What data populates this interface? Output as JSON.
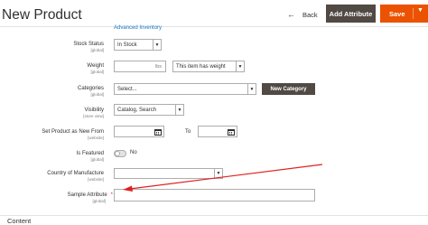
{
  "header": {
    "title": "New Product",
    "back_label": "Back",
    "add_attribute_label": "Add Attribute",
    "save_label": "Save"
  },
  "advanced_link": "Advanced Inventory",
  "form": {
    "stock_status": {
      "label": "Stock Status",
      "scope": "[global]",
      "value": "In Stock"
    },
    "weight": {
      "label": "Weight",
      "scope": "[global]",
      "value": "",
      "unit": "lbs",
      "has_weight": "This item has weight"
    },
    "categories": {
      "label": "Categories",
      "scope": "[global]",
      "placeholder": "Select...",
      "new_category_label": "New Category"
    },
    "visibility": {
      "label": "Visibility",
      "scope": "[store view]",
      "value": "Catalog, Search"
    },
    "new_from": {
      "label": "Set Product as New From",
      "scope": "[website]",
      "from_value": "",
      "to_label": "To",
      "to_value": ""
    },
    "is_featured": {
      "label": "Is Featured",
      "scope": "[global]",
      "state_text": "No"
    },
    "country": {
      "label": "Country of Manufacture",
      "scope": "[website]",
      "value": ""
    },
    "sample_attribute": {
      "label": "Sample Attribute",
      "scope": "[global]",
      "value": ""
    }
  },
  "section": {
    "content_title": "Content"
  },
  "colors": {
    "accent": "#eb5202",
    "dark_button": "#514943",
    "link": "#1979c3",
    "annotation_arrow": "#e02020"
  }
}
